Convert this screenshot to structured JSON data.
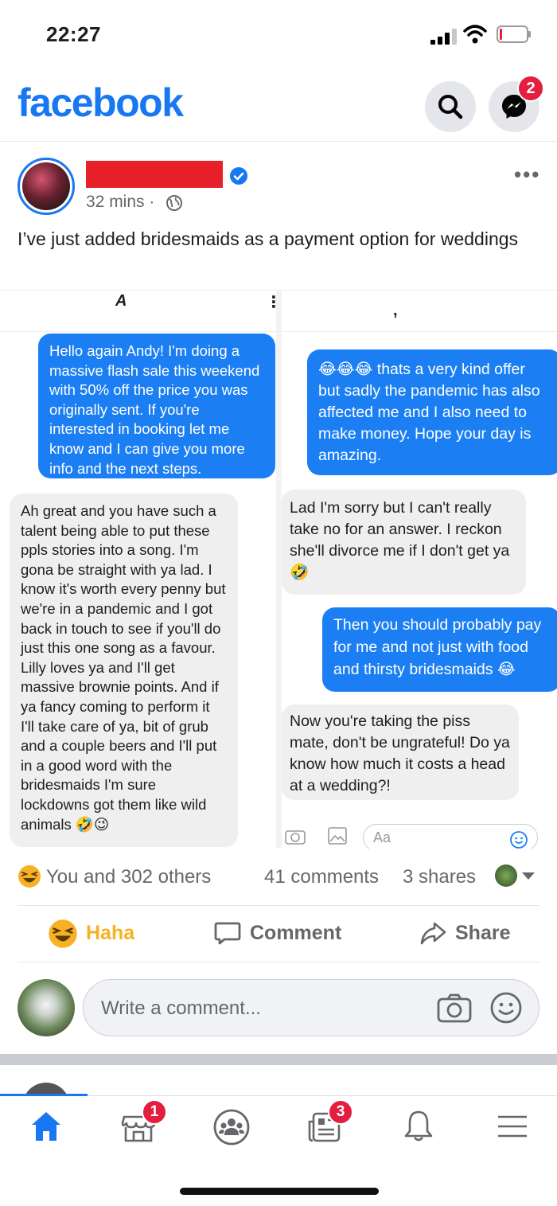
{
  "status_bar": {
    "time": "22:27"
  },
  "header": {
    "logo": "facebook",
    "messenger_badge": "2"
  },
  "post": {
    "time": "32 mins",
    "separator": "·",
    "text": "I’ve just added bridesmaids as a payment option for weddings"
  },
  "screenshot": {
    "left_header_char": "A",
    "right_header_char": ",",
    "left_messages": [
      {
        "dir": "out",
        "text": "Hello again Andy! I'm doing a massive flash sale this weekend with 50% off the price you was originally sent. If you're interested in booking let me know and I can give you more info and the next steps."
      },
      {
        "dir": "in",
        "text": "Ah great and you have such a talent being able to put these ppls stories into a song. I'm gona be straight with ya lad. I know it's worth every penny but we're in a pandemic and I got back in touch to see if you'll do just this one song as a favour. Lilly loves ya and I'll get massive brownie points. And if ya fancy coming to perform it I'll take care of ya, bit of grub and a couple beers and I'll put in a good word with the bridesmaids I'm sure lockdowns got them like wild animals 🤣😉"
      }
    ],
    "right_messages": [
      {
        "dir": "out",
        "text": "😂😂😂 thats a very kind offer but sadly the pandemic has also affected me and I also need to make money. Hope your day is amazing."
      },
      {
        "dir": "in",
        "text": "Lad I'm sorry but I can't really take no for an answer. I reckon she'll divorce me if I don't get ya🤣"
      },
      {
        "dir": "out",
        "text": "Then you should probably pay for me and not just with food and thirsty bridesmaids 😂"
      },
      {
        "dir": "in",
        "text": "Now you're taking the piss mate, don't be ungrateful! Do ya know how much it costs a head at a wedding?!"
      }
    ],
    "composer_placeholder": "Aa"
  },
  "reactions": {
    "who": "You and 302 others",
    "comments": "41 comments",
    "shares": "3 shares"
  },
  "actions": {
    "haha": "Haha",
    "comment": "Comment",
    "share": "Share"
  },
  "comment_box": {
    "placeholder": "Write a comment..."
  },
  "tabbar": {
    "marketplace_badge": "1",
    "feeds_badge": "3"
  },
  "colors": {
    "brand": "#1877f2",
    "badge": "#e41e3f",
    "bubble_out": "#1b7ff3",
    "bubble_in": "#efefef",
    "haha": "#f7b125"
  }
}
